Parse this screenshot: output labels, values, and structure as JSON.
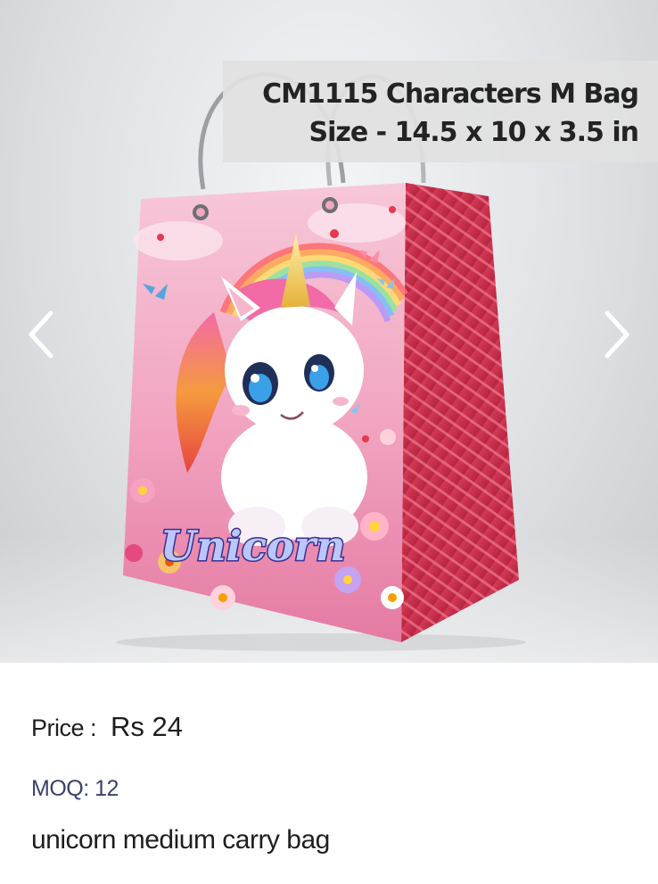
{
  "product": {
    "title_line1": "CM1115 Characters M Bag",
    "title_line2": "Size - 14.5 x 10 x 3.5 in",
    "price_label": "Price :",
    "price_value": "Rs 24",
    "moq": "MOQ: 12",
    "description": "unicorn medium carry bag",
    "bag_print_text": "Unicorn"
  },
  "icons": {
    "prev": "chevron-left-icon",
    "next": "chevron-right-icon"
  },
  "colors": {
    "bag_pink": "#f3a3c3",
    "bag_side": "#c8344e",
    "title_bg": "#e1e1e1",
    "moq_text": "#3b3f6b"
  }
}
